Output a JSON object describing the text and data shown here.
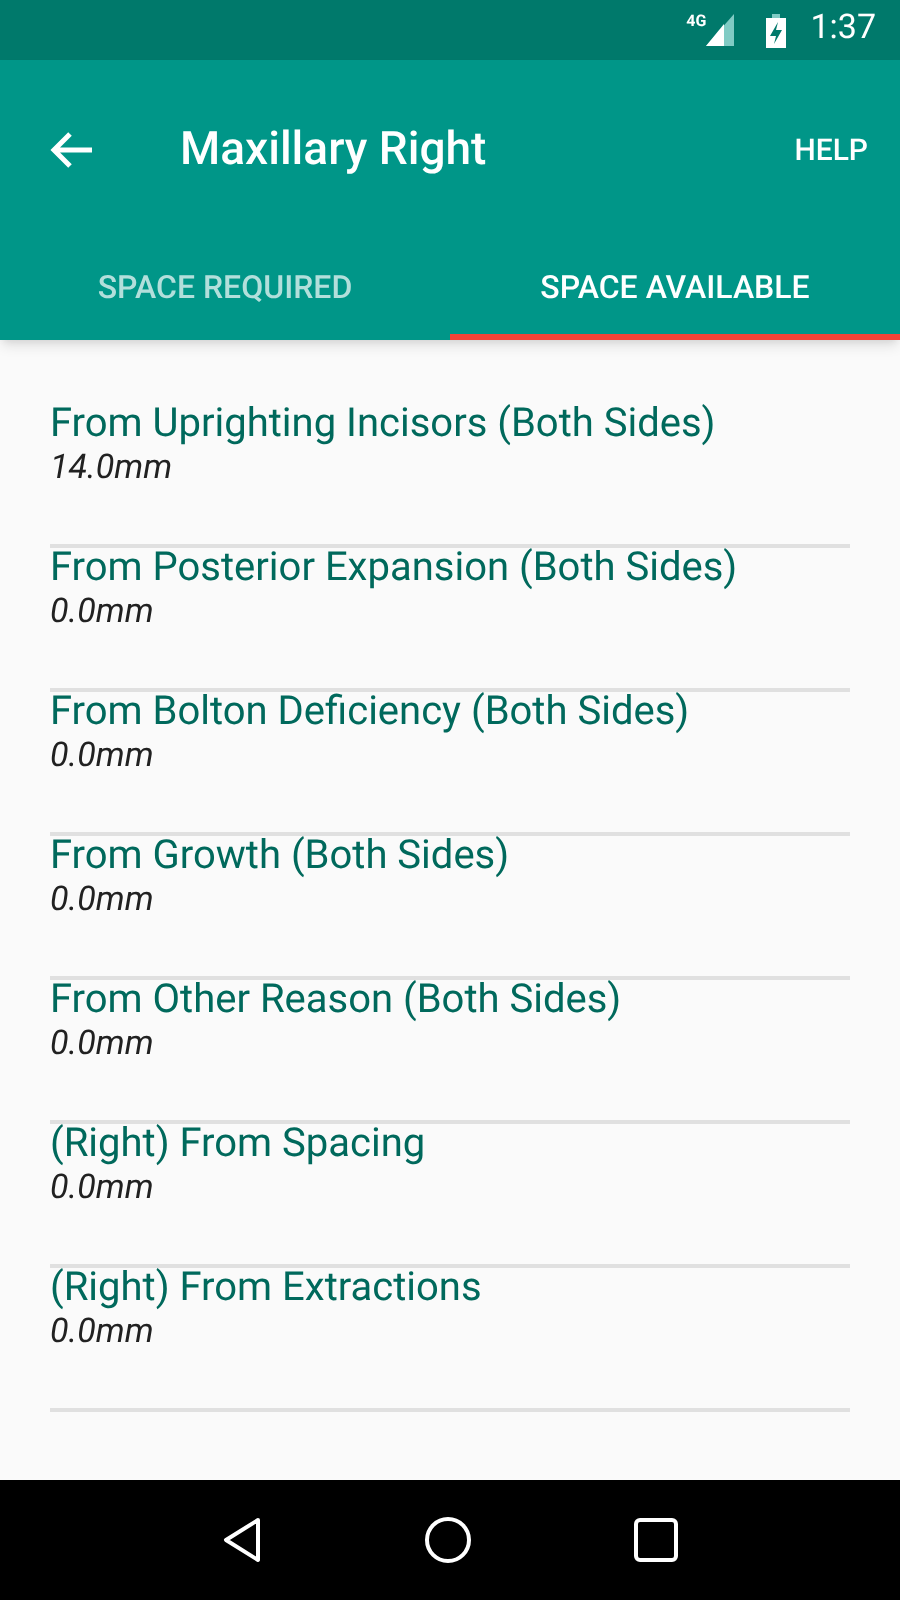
{
  "status_bar": {
    "network": "4G",
    "time": "1:37"
  },
  "toolbar": {
    "title": "Maxillary Right",
    "action": "HELP"
  },
  "tabs": [
    {
      "label": "SPACE REQUIRED",
      "selected": false
    },
    {
      "label": "SPACE AVAILABLE",
      "selected": true
    }
  ],
  "items": [
    {
      "title": "From Uprighting Incisors (Both Sides)",
      "value": "14.0mm"
    },
    {
      "title": "From Posterior Expansion (Both Sides)",
      "value": "0.0mm"
    },
    {
      "title": "From Bolton Deficiency (Both Sides)",
      "value": "0.0mm"
    },
    {
      "title": "From Growth (Both Sides)",
      "value": "0.0mm"
    },
    {
      "title": "From Other Reason (Both Sides)",
      "value": "0.0mm"
    },
    {
      "title": "(Right) From Spacing",
      "value": "0.0mm"
    },
    {
      "title": "(Right) From Extractions",
      "value": "0.0mm"
    }
  ]
}
